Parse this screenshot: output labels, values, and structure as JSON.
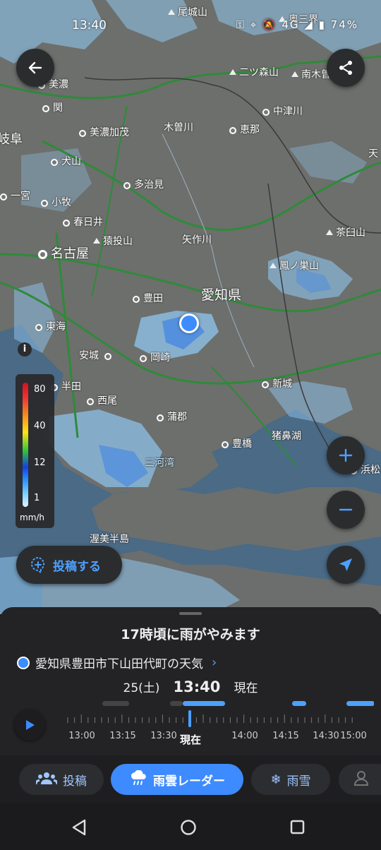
{
  "status_bar": {
    "time": "13:40",
    "icons_text": "⚿ ⌖ 🔕 4G ◢ ▮",
    "battery": "74%"
  },
  "map": {
    "places": {
      "owase": "尾城山",
      "okumikawa": "奥三界",
      "futatsumori": "二ツ森山",
      "minamikiso": "南木曽岳",
      "mino": "美濃",
      "seki": "関",
      "nakatsugawa": "中津川",
      "gifu": "岐阜",
      "minokamo": "美濃加茂",
      "kisogawa": "木曽川",
      "ena": "恵那",
      "ten": "天",
      "inuyama": "犬山",
      "tajimi": "多治見",
      "ichinomiya": "一宮",
      "komaki": "小牧",
      "kasugai": "春日井",
      "sarunage": "猿投山",
      "yahagi": "矢作川",
      "chausu": "茶臼山",
      "nagoya": "名古屋",
      "horaiji": "鳳ノ巣山",
      "toyota": "豊田",
      "aichi": "愛知県",
      "tokai": "東海",
      "anjo": "安城",
      "okazaki": "岡崎",
      "handa": "半田",
      "shinshiro": "新城",
      "nishio": "西尾",
      "gamagori": "蒲郡",
      "inosasako": "猪鼻湖",
      "toyohashi": "豊橋",
      "mikawa_bay": "三河湾",
      "hamamatsu": "浜松",
      "atsumi": "渥美半島"
    },
    "legend": {
      "values": [
        "80",
        "40",
        "12",
        "1"
      ],
      "unit": "mm/h"
    },
    "post_button": "投稿する"
  },
  "sheet": {
    "headline": "17時頃に雨がやみます",
    "location": "愛知県豊田市下山田代町の天気",
    "date": "25(土)",
    "time": "13:40",
    "now": "現在",
    "timeline_labels": [
      "13:00",
      "13:15",
      "13:30",
      "14:00",
      "14:15",
      "14:30",
      "15:00"
    ],
    "now_label": "現在"
  },
  "tabs": {
    "post": "投稿",
    "radar": "雨雲レーダー",
    "rain_snow": "雨雪"
  },
  "colors": {
    "accent": "#3d8bff",
    "rain_light": "#8fc6ef",
    "rain_mid": "#4c8be0",
    "sea": "#4a6a86"
  }
}
